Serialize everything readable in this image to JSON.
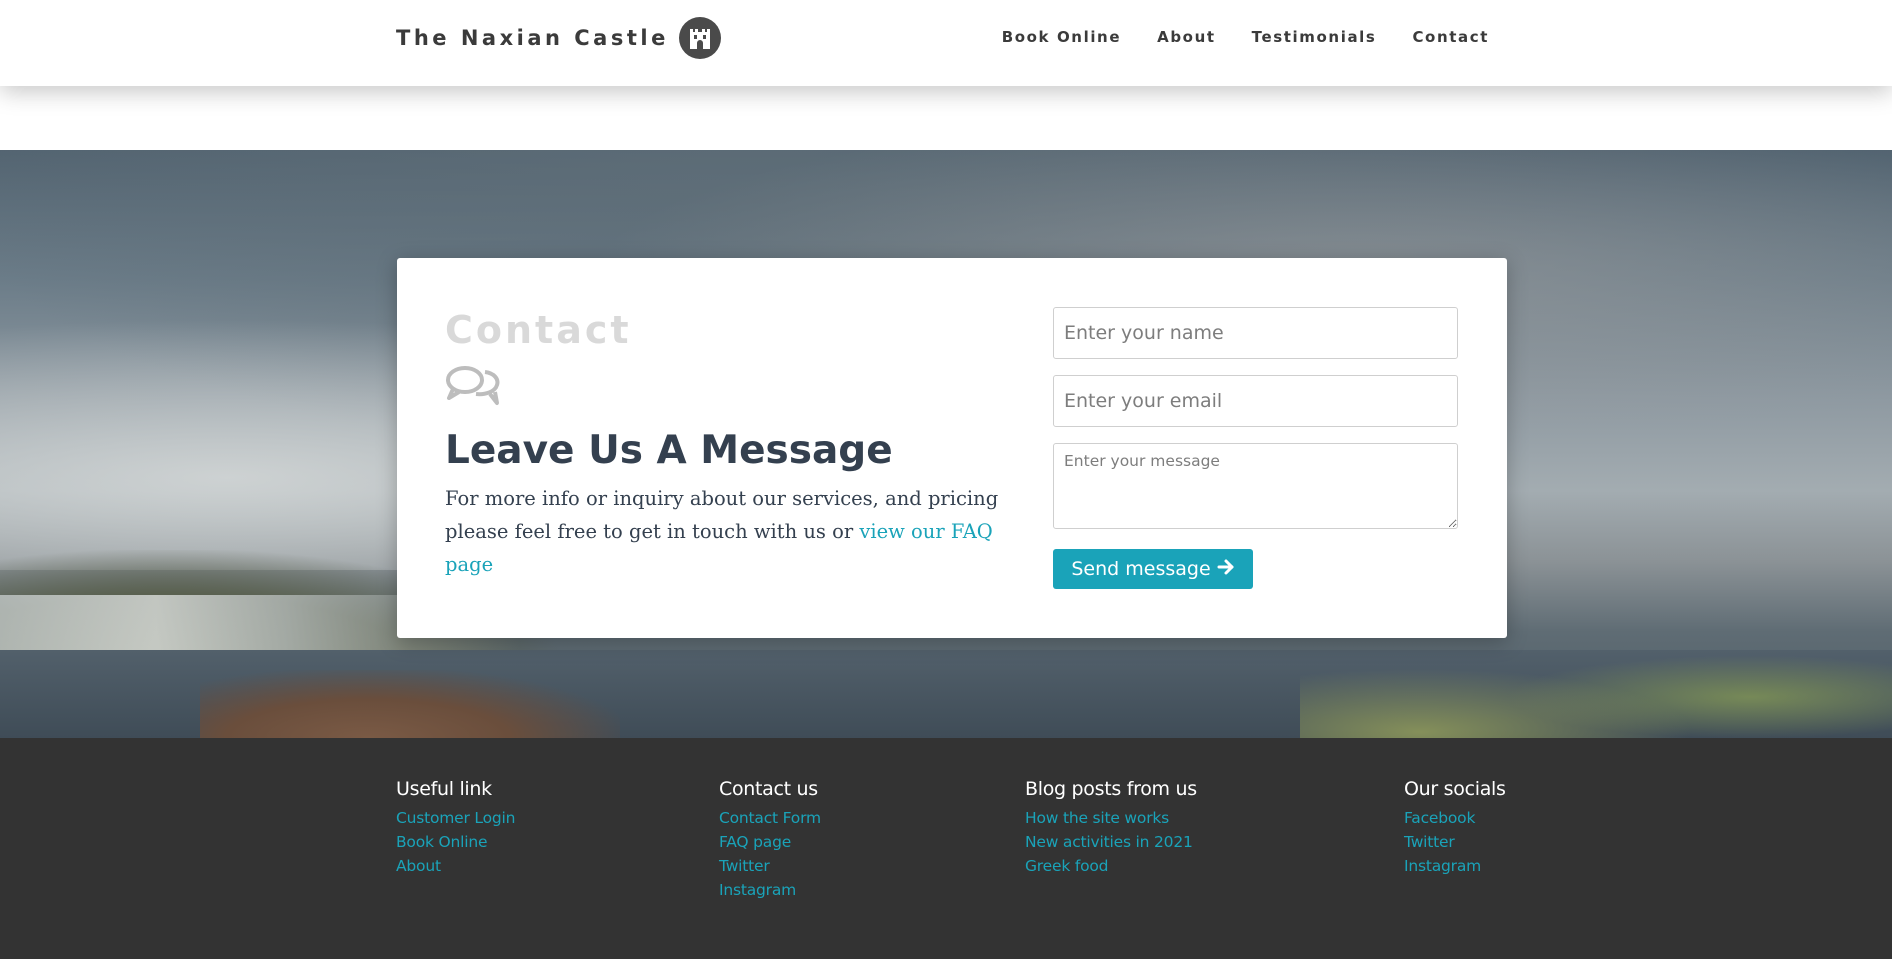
{
  "nav": {
    "brand": "The Naxian Castle",
    "links": [
      "Book Online",
      "About",
      "Testimonials",
      "Contact"
    ]
  },
  "contact": {
    "kicker": "Contact",
    "title": "Leave Us A Message",
    "text": "For more info or inquiry about our services, and pricing please feel free to get in touch with us or ",
    "faq_link": "view our FAQ page",
    "name_placeholder": "Enter your name",
    "email_placeholder": "Enter your email",
    "message_placeholder": "Enter your message",
    "send_label": "Send message"
  },
  "footer": {
    "columns": [
      {
        "title": "Useful link",
        "links": [
          "Customer Login",
          "Book Online",
          "About"
        ]
      },
      {
        "title": "Contact us",
        "links": [
          "Contact Form",
          "FAQ page",
          "Twitter",
          "Instagram"
        ]
      },
      {
        "title": "Blog posts from us",
        "links": [
          "How the site works",
          "New activities in 2021",
          "Greek food"
        ]
      },
      {
        "title": "Our socials",
        "links": [
          "Facebook",
          "Twitter",
          "Instagram"
        ]
      }
    ]
  },
  "colors": {
    "accent": "#1aa3b9",
    "heading": "#34404f",
    "footer_bg": "#333333",
    "kicker": "#d9d9d9"
  },
  "icons": {
    "logo": "castle-icon",
    "chat": "comments-icon",
    "send": "arrow-right-icon"
  }
}
